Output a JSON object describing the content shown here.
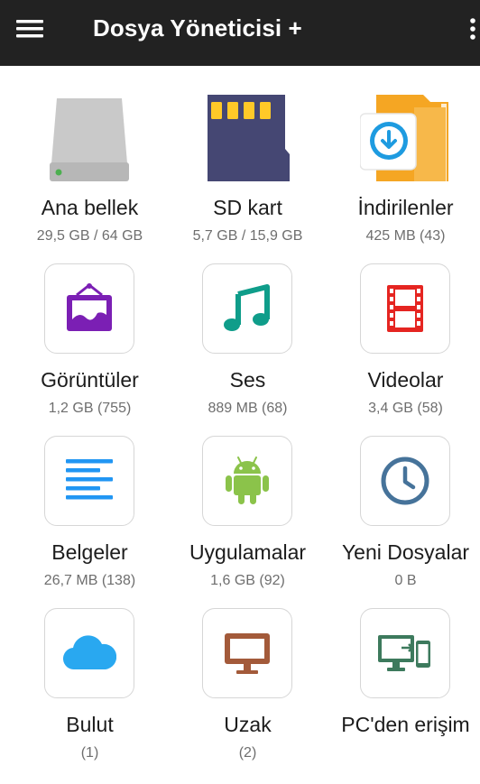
{
  "app": {
    "title": "Dosya Yöneticisi +"
  },
  "tiles": [
    {
      "label": "Ana bellek",
      "sub": "29,5 GB / 64 GB",
      "icon": "hard-drive-icon"
    },
    {
      "label": "SD kart",
      "sub": "5,7 GB / 15,9 GB",
      "icon": "sd-card-icon"
    },
    {
      "label": "İndirilenler",
      "sub": "425 MB (43)",
      "icon": "downloads-folder-icon"
    },
    {
      "label": "Görüntüler",
      "sub": "1,2 GB (755)",
      "icon": "picture-frame-icon",
      "color": "#7b1fb4"
    },
    {
      "label": "Ses",
      "sub": "889 MB (68)",
      "icon": "music-note-icon",
      "color": "#0f9d8a"
    },
    {
      "label": "Videolar",
      "sub": "3,4 GB (58)",
      "icon": "film-strip-icon",
      "color": "#e52521"
    },
    {
      "label": "Belgeler",
      "sub": "26,7 MB (138)",
      "icon": "document-lines-icon",
      "color": "#2196f3"
    },
    {
      "label": "Uygulamalar",
      "sub": "1,6 GB (92)",
      "icon": "android-icon",
      "color": "#8bc34a"
    },
    {
      "label": "Yeni Dosyalar",
      "sub": "0 B",
      "icon": "clock-icon",
      "color": "#46739a"
    },
    {
      "label": "Bulut",
      "sub": "(1)",
      "icon": "cloud-icon",
      "color": "#29a8f0"
    },
    {
      "label": "Uzak",
      "sub": "(2)",
      "icon": "monitor-icon",
      "color": "#a35a3a"
    },
    {
      "label": "PC'den erişim",
      "sub": "",
      "icon": "pc-transfer-icon",
      "color": "#3d7a5d"
    }
  ]
}
